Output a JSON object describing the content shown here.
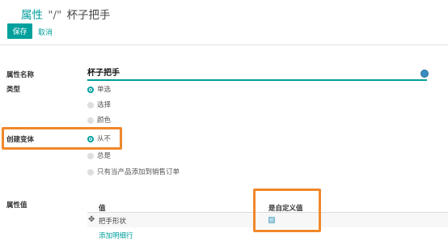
{
  "header": {
    "breadcrumb": "属性",
    "separator": "\"/\"",
    "record_name": "杯子把手"
  },
  "toolbar": {
    "save_label": "保存",
    "cancel_label": "取消"
  },
  "form": {
    "name_label": "属性名称",
    "name_value": "杯子把手",
    "type_label": "类型",
    "type_options": [
      {
        "label": "单选",
        "checked": true
      },
      {
        "label": "选择",
        "checked": false
      },
      {
        "label": "颜色",
        "checked": false
      }
    ],
    "create_variant_label": "创建变体",
    "create_variant_options": [
      {
        "label": "从不",
        "checked": true
      },
      {
        "label": "总是",
        "checked": false
      },
      {
        "label": "只有当产品添加到销售订单",
        "checked": false
      }
    ],
    "values_label": "属性值"
  },
  "values_table": {
    "columns": [
      "值",
      "是自定义值"
    ],
    "rows": [
      {
        "value": "把手形状",
        "is_custom": true
      }
    ],
    "add_line": "添加明细行"
  },
  "colors": {
    "accent": "#00a09d",
    "highlight": "#f0882b"
  }
}
